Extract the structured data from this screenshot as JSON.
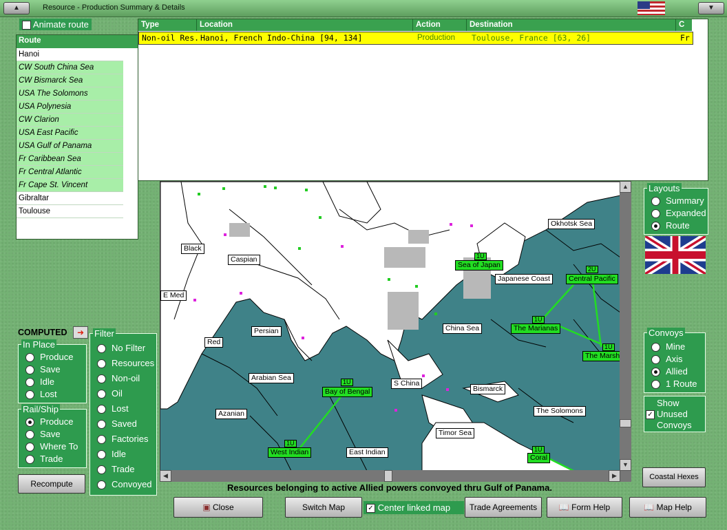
{
  "window": {
    "title": "Resource - Production Summary & Details"
  },
  "animate_route": {
    "label": "Animate route",
    "checked": false
  },
  "route": {
    "header": "Route",
    "items": [
      {
        "label": "Hanoi",
        "waypoint": false
      },
      {
        "label": "CW South China Sea",
        "waypoint": true
      },
      {
        "label": "CW Bismarck Sea",
        "waypoint": true
      },
      {
        "label": "USA The Solomons",
        "waypoint": true
      },
      {
        "label": "USA Polynesia",
        "waypoint": true
      },
      {
        "label": "CW Clarion",
        "waypoint": true
      },
      {
        "label": "USA East Pacific",
        "waypoint": true
      },
      {
        "label": "USA Gulf of Panama",
        "waypoint": true
      },
      {
        "label": "Fr Caribbean Sea",
        "waypoint": true
      },
      {
        "label": "Fr Central Atlantic",
        "waypoint": true
      },
      {
        "label": "Fr Cape St. Vincent",
        "waypoint": true
      },
      {
        "label": "Gibraltar",
        "waypoint": false
      },
      {
        "label": "Toulouse",
        "waypoint": false
      }
    ]
  },
  "table": {
    "columns": [
      "Type",
      "Location",
      "Action",
      "Destination",
      "C"
    ],
    "rows": [
      [
        "Non-oil Res.",
        "Hanoi, French Indo-China [94, 134]",
        "Production",
        "Toulouse, France [63, 26]",
        "Fr"
      ]
    ]
  },
  "map": {
    "labels": [
      {
        "text": "Black",
        "green": false
      },
      {
        "text": "Caspian",
        "green": false
      },
      {
        "text": "E Med",
        "green": false
      },
      {
        "text": "Persian",
        "green": false
      },
      {
        "text": "Red",
        "green": false
      },
      {
        "text": "Arabian Sea",
        "green": false
      },
      {
        "text": "Azanian",
        "green": false
      },
      {
        "text": "Bay of Bengal",
        "green": true,
        "badge": "1U"
      },
      {
        "text": "West Indian",
        "green": true,
        "badge": "1U"
      },
      {
        "text": "East Indian",
        "green": false
      },
      {
        "text": "S China",
        "green": false
      },
      {
        "text": "China Sea",
        "green": false
      },
      {
        "text": "Bismarck",
        "green": false
      },
      {
        "text": "Timor Sea",
        "green": false
      },
      {
        "text": "The Solomons",
        "green": false
      },
      {
        "text": "Coral",
        "green": true,
        "badge": "1U"
      },
      {
        "text": "Sea of Japan",
        "green": true,
        "badge": "1U"
      },
      {
        "text": "Japanese Coast",
        "green": false
      },
      {
        "text": "Okhotsk Sea",
        "green": false
      },
      {
        "text": "Central Pacific",
        "green": true,
        "badge": "2U"
      },
      {
        "text": "The Marianas",
        "green": true,
        "badge": "1U"
      },
      {
        "text": "The Marsh",
        "green": true,
        "badge": "1U"
      }
    ],
    "colors": {
      "sea": "#3f8288",
      "land": "#ffffff",
      "convoy": "#22dd22"
    }
  },
  "computed": {
    "label": "COMPUTED"
  },
  "in_place": {
    "title": "In Place",
    "options": [
      "Produce",
      "Save",
      "Idle",
      "Lost"
    ],
    "selected": null
  },
  "rail_ship": {
    "title": "Rail/Ship",
    "options": [
      "Produce",
      "Save",
      "Where To",
      "Trade"
    ],
    "selected": "Produce"
  },
  "filter": {
    "title": "Filter",
    "options": [
      "No Filter",
      "Resources",
      "Non-oil",
      "Oil",
      "Lost",
      "Saved",
      "Factories",
      "Idle",
      "Trade",
      "Convoyed"
    ],
    "selected": null
  },
  "recompute": {
    "label": "Recompute"
  },
  "layouts": {
    "title": "Layouts",
    "options": [
      "Summary",
      "Expanded",
      "Route"
    ],
    "selected": "Route"
  },
  "convoys": {
    "title": "Convoys",
    "options": [
      "Mine",
      "Axis",
      "Allied",
      "1 Route"
    ],
    "selected": "Allied"
  },
  "show_unused": {
    "label1": "Show",
    "label2": "Unused",
    "label3": "Convoys",
    "checked": true
  },
  "coastal_hexes": {
    "label": "Coastal Hexes"
  },
  "status": {
    "text": "Resources belonging to active Allied powers convoyed thru Gulf of Panama."
  },
  "bottom": {
    "close": "Close",
    "switch_map": "Switch Map",
    "center_linked": "Center linked map",
    "trade_agreements": "Trade Agreements",
    "form_help": "Form Help",
    "map_help": "Map Help"
  }
}
